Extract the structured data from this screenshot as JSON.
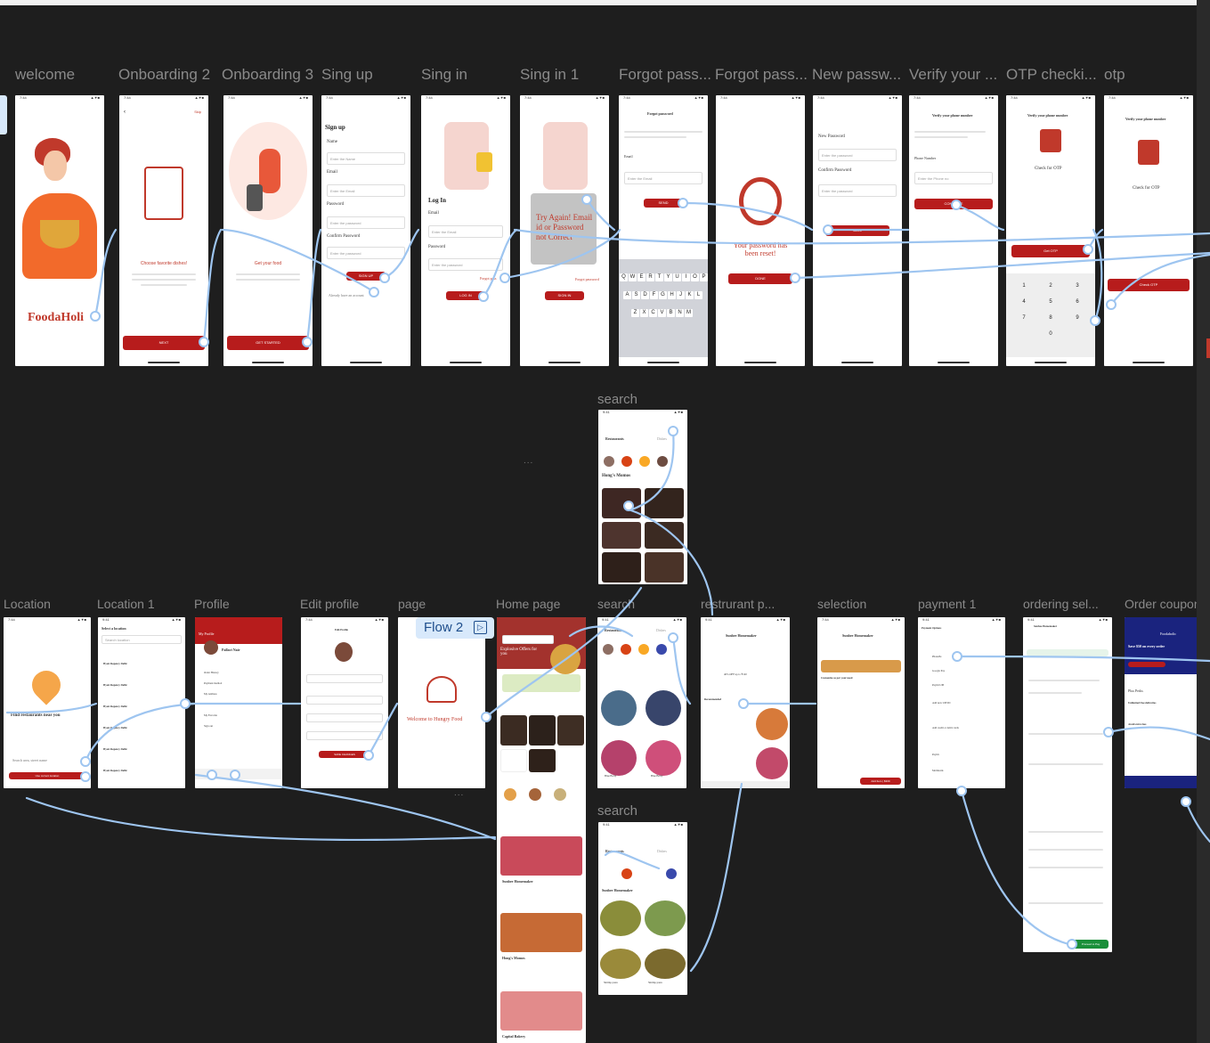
{
  "frames_row1": [
    {
      "id": "welcome",
      "label": "welcome"
    },
    {
      "id": "onb2",
      "label": "Onboarding 2"
    },
    {
      "id": "onb3",
      "label": "Onboarding 3"
    },
    {
      "id": "signup",
      "label": "Sing up"
    },
    {
      "id": "signin",
      "label": "Sing in"
    },
    {
      "id": "signin1",
      "label": "Sing in 1"
    },
    {
      "id": "forgot1",
      "label": "Forgot pass..."
    },
    {
      "id": "forgot2",
      "label": "Forgot pass..."
    },
    {
      "id": "newpass",
      "label": "New passw..."
    },
    {
      "id": "verify",
      "label": "Verify your ..."
    },
    {
      "id": "otpcheck",
      "label": "OTP checki..."
    },
    {
      "id": "otp",
      "label": "otp"
    }
  ],
  "frames_row2": [
    {
      "id": "location",
      "label": "Location"
    },
    {
      "id": "location1",
      "label": "Location 1"
    },
    {
      "id": "profile",
      "label": "Profile"
    },
    {
      "id": "editprofile",
      "label": "Edit profile"
    },
    {
      "id": "page",
      "label": "page"
    },
    {
      "id": "homepage",
      "label": "Home page"
    },
    {
      "id": "search",
      "label": "search"
    },
    {
      "id": "restaurant",
      "label": "restrurant p..."
    },
    {
      "id": "selection",
      "label": "selection"
    },
    {
      "id": "payment1",
      "label": "payment 1"
    },
    {
      "id": "ordering",
      "label": "ordering sel..."
    },
    {
      "id": "coupon",
      "label": "Order coupon"
    }
  ],
  "search_top_label": "search",
  "search_bottom_label": "search",
  "flow_tag": "Flow 2",
  "welcome": {
    "brand": "FoodaHoli"
  },
  "onb2": {
    "title": "Choose favorite dishes!",
    "btn": "NEXT",
    "skip": "Skip"
  },
  "onb3": {
    "title": "Get your food",
    "btn": "GET STARTED"
  },
  "signup": {
    "title": "Sign up",
    "name": "Name",
    "name_ph": "Enter the Name",
    "email": "Email",
    "email_ph": "Enter the Email",
    "password": "Password",
    "password_ph": "Enter the password",
    "confirm": "Confirm Password",
    "confirm_ph": "Enter the password",
    "btn": "SIGN UP",
    "footer": "Already have an account"
  },
  "signin": {
    "title": "Log In",
    "email": "Email",
    "email_ph": "Enter the Email",
    "password": "Password",
    "password_ph": "Enter the password",
    "forgot": "Forgot pass",
    "btn": "LOG IN"
  },
  "signin1": {
    "error": "Try Again! Email id or Password not Correct",
    "forgot": "Forgot password",
    "btn": "SIGN IN"
  },
  "forgot1": {
    "title": "Forgot password",
    "email": "Email",
    "email_ph": "Enter the Email",
    "btn": "SEND",
    "keys_row1": [
      "Q",
      "W",
      "E",
      "R",
      "T",
      "Y",
      "U",
      "I",
      "O",
      "P"
    ],
    "keys_row2": [
      "A",
      "S",
      "D",
      "F",
      "G",
      "H",
      "J",
      "K",
      "L"
    ],
    "keys_row3": [
      "Z",
      "X",
      "C",
      "V",
      "B",
      "N",
      "M"
    ]
  },
  "forgot2": {
    "msg": "Your password has been reset!",
    "btn": "DONE"
  },
  "newpass": {
    "new": "New Password",
    "new_ph": "Enter the password",
    "confirm": "Confirm Password",
    "confirm_ph": "Enter the password",
    "btn": "SAVE"
  },
  "verify": {
    "title": "Verify your phone number",
    "phone": "Phone Number",
    "phone_ph": "Enter the Phone no",
    "btn": "CONTINUE"
  },
  "otpcheck": {
    "title": "Verify your phone number",
    "sub": "Check for OTP",
    "btn": "Get OTP",
    "keys": [
      "1",
      "2",
      "3",
      "4",
      "5",
      "6",
      "7",
      "8",
      "9",
      "0"
    ]
  },
  "otp": {
    "title": "Verify your phone number",
    "sub": "Check for OTP",
    "btn": "Check OTP"
  },
  "location": {
    "text": "Find restaurants near you",
    "btn": "Use current location",
    "search": "Search area, street name"
  },
  "location1": {
    "title": "Select a location",
    "search": "Search location",
    "items": [
      "Hyatt Regency Delhi",
      "Hyatt Regency Delhi",
      "Hyatt Regency Delhi",
      "Hyatt Regency Delhi",
      "Hyatt Regency Delhi",
      "Hyatt Regency Delhi"
    ]
  },
  "profile": {
    "title": "My Profile",
    "name": "Pallavi Nair",
    "items": [
      "Order History",
      "Payment method",
      "My Address",
      "My Favorite",
      "Sign out"
    ]
  },
  "editprofile": {
    "title": "Edit Profile",
    "btn": "SAVE CHANGES"
  },
  "page": {
    "text": "Welcome to Hungry Food"
  },
  "homepage": {
    "banner": "Explosive Offers for you",
    "cards": [
      "Sunbee Homemaker",
      "Hong's Momos",
      "Capital Bakery"
    ]
  },
  "search": {
    "tabs": [
      "Restaurants",
      "Dishes"
    ],
    "restaurant": "Hong's Momos",
    "restaurant2": "Sunbee Homemaker",
    "items": [
      "Blue Berry",
      "Blue Berry",
      "Shrimp pasta",
      "Shrimp pasta"
    ]
  },
  "restaurant": {
    "title": "Sunbee Homemaker",
    "offer": "40% OFF up to ₹120",
    "section": "Recommended"
  },
  "selection": {
    "title": "Sunbee Homemaker",
    "section": "Customize as per your need",
    "btn": "Add Item | $309"
  },
  "payment1": {
    "title": "Payment Options",
    "items": [
      "PhonePe",
      "Google Pay",
      "Paytm UPI",
      "Add new UPI ID",
      "Add credit or debit cards",
      "Paytm",
      "Mobikwik",
      "Amazon Pay"
    ]
  },
  "ordering": {
    "title": "Sunbee Homemaker",
    "btn": "Proceed to Pay"
  },
  "coupon": {
    "brand": "Foodaholic",
    "headline": "Save $50 on every order",
    "perks": "Plus Perks",
    "free": "Unlimited free deliveries",
    "fees": "Avoid extra fees"
  }
}
